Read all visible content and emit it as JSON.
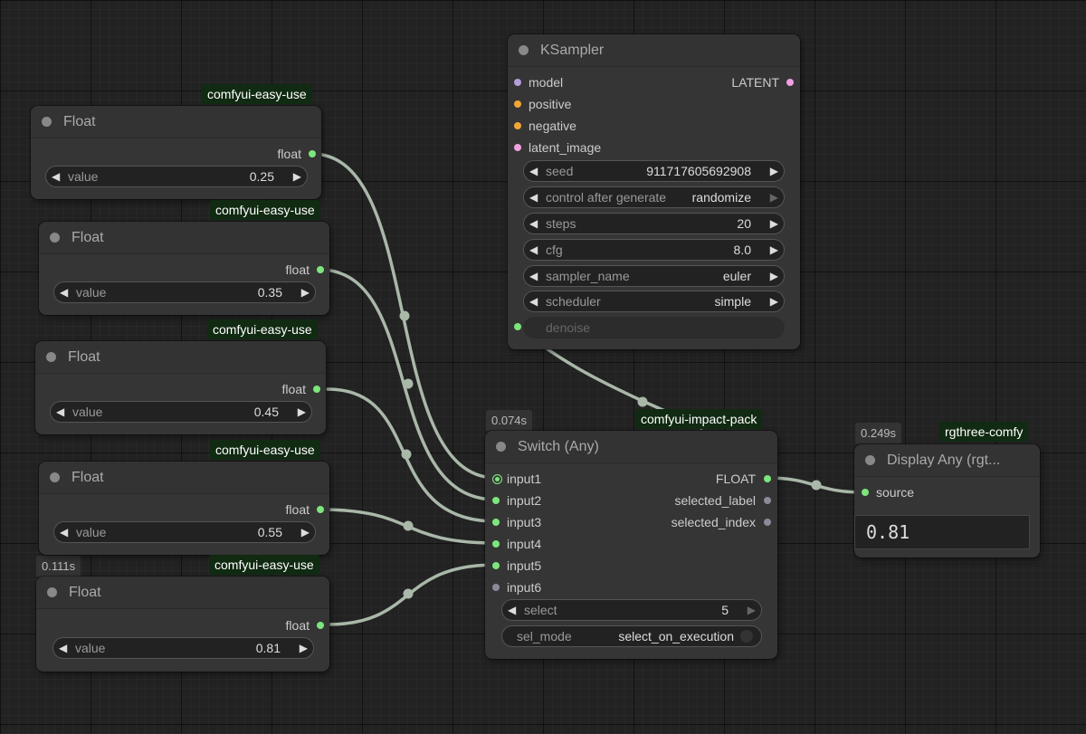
{
  "float_nodes": [
    {
      "title": "Float",
      "output": "float",
      "widget_label": "value",
      "value": "0.25",
      "tag": "comfyui-easy-use"
    },
    {
      "title": "Float",
      "output": "float",
      "widget_label": "value",
      "value": "0.35",
      "tag": "comfyui-easy-use"
    },
    {
      "title": "Float",
      "output": "float",
      "widget_label": "value",
      "value": "0.45",
      "tag": "comfyui-easy-use"
    },
    {
      "title": "Float",
      "output": "float",
      "widget_label": "value",
      "value": "0.55",
      "tag": "comfyui-easy-use"
    },
    {
      "title": "Float",
      "output": "float",
      "widget_label": "value",
      "value": "0.81",
      "tag": "comfyui-easy-use",
      "time": "0.111s"
    }
  ],
  "ksampler": {
    "title": "KSampler",
    "inputs": [
      "model",
      "positive",
      "negative",
      "latent_image"
    ],
    "output": "LATENT",
    "widgets": [
      {
        "label": "seed",
        "value": "911717605692908"
      },
      {
        "label": "control after generate",
        "value": "randomize"
      },
      {
        "label": "steps",
        "value": "20"
      },
      {
        "label": "cfg",
        "value": "8.0"
      },
      {
        "label": "sampler_name",
        "value": "euler"
      },
      {
        "label": "scheduler",
        "value": "simple"
      }
    ],
    "denoise_label": "denoise"
  },
  "switch": {
    "title": "Switch (Any)",
    "time": "0.074s",
    "tag": "comfyui-impact-pack",
    "inputs": [
      "input1",
      "input2",
      "input3",
      "input4",
      "input5",
      "input6"
    ],
    "outputs": [
      "FLOAT",
      "selected_label",
      "selected_index"
    ],
    "select_label": "select",
    "select_value": "5",
    "sel_mode_label": "sel_mode",
    "sel_mode_value": "select_on_execution"
  },
  "display": {
    "title": "Display Any (rgt...",
    "time": "0.249s",
    "tag": "rgthree-comfy",
    "input": "source",
    "value": "0.81"
  },
  "colors": {
    "canvas": "#222222",
    "node": "#353535",
    "wire": "#a9b8a9",
    "slot_connected": "#7ce67c",
    "tag_bg": "#112a12"
  }
}
